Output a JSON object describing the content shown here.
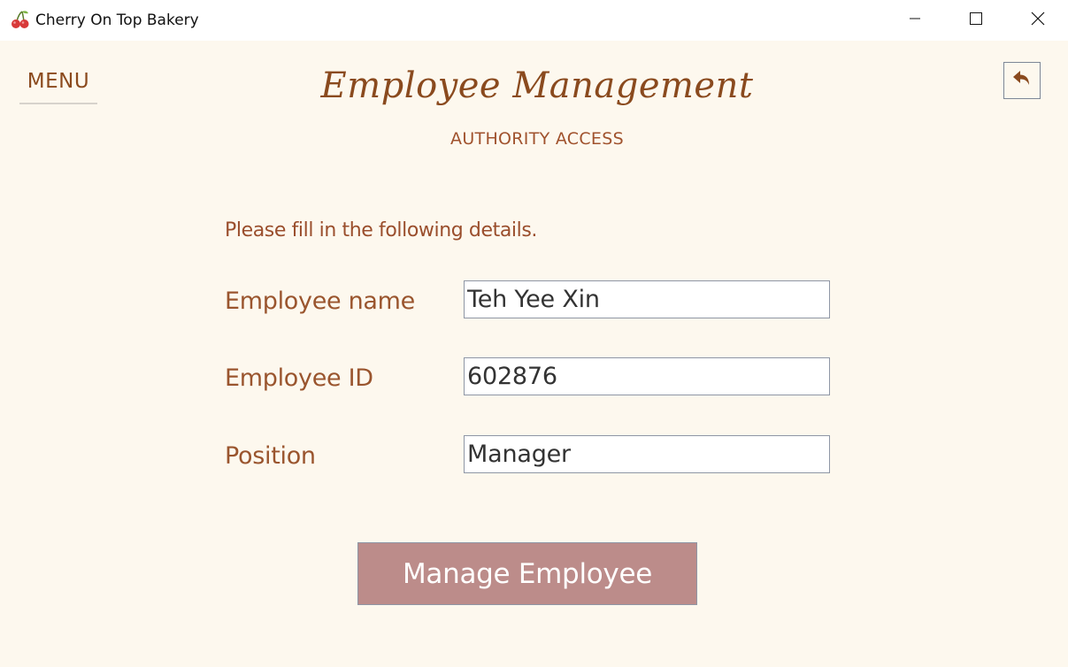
{
  "window": {
    "title": "Cherry On Top Bakery",
    "icon": "cherry-icon",
    "controls": {
      "minimize": "minimize-icon",
      "maximize": "maximize-icon",
      "close": "close-icon"
    }
  },
  "header": {
    "menu_label": "MENU",
    "title": "Employee Management",
    "subtitle": "AUTHORITY ACCESS",
    "back_icon": "back-arrow-icon"
  },
  "form": {
    "instruction": "Please fill in the following details.",
    "fields": [
      {
        "label": "Employee name",
        "value": "Teh Yee Xin"
      },
      {
        "label": "Employee ID",
        "value": "602876"
      },
      {
        "label": "Position",
        "value": "Manager"
      }
    ],
    "submit_label": "Manage Employee"
  },
  "colors": {
    "background": "#fdf8ee",
    "accent_brown": "#8a4a1e",
    "button_fill": "#bc8c8a"
  }
}
